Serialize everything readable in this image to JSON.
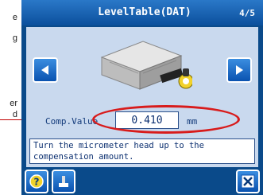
{
  "margin": {
    "lines": [
      "e",
      "g",
      "er",
      "d"
    ]
  },
  "header": {
    "title": "LevelTable(DAT)",
    "page": "4/5"
  },
  "main": {
    "comp_label": "Comp.Value",
    "comp_value": "0.410",
    "unit": "mm",
    "message": "Turn the micrometer head up to the\ncompensation amount."
  },
  "icons": {
    "prev": "arrow-left-icon",
    "next": "arrow-right-icon",
    "help": "help-icon",
    "tool": "tool-icon",
    "close": "close-icon"
  },
  "colors": {
    "screen_bg": "#0a4a8a",
    "panel_bg": "#c9d9ee",
    "button": "#0a52b0",
    "highlight": "#d81b1b"
  }
}
